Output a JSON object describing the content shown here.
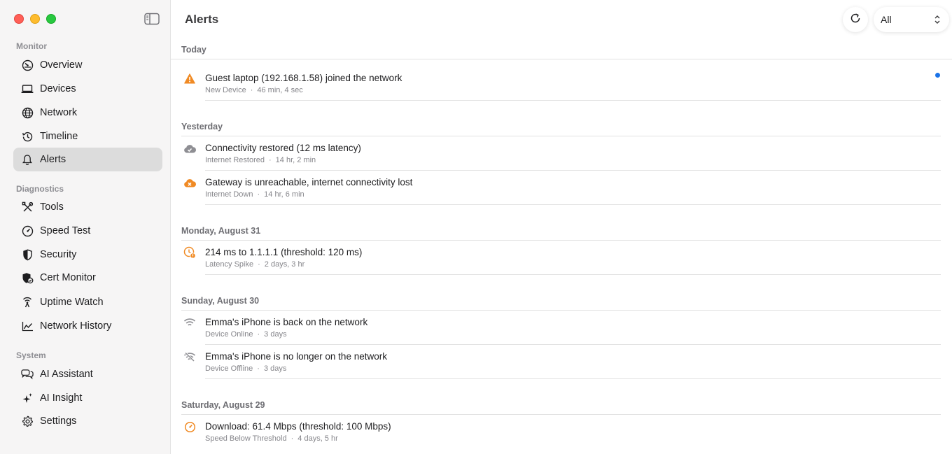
{
  "window": {
    "sidebar": {
      "sections": [
        {
          "label": "Monitor",
          "items": [
            {
              "label": "Overview",
              "icon": "overview-gauge-icon"
            },
            {
              "label": "Devices",
              "icon": "laptop-icon"
            },
            {
              "label": "Network",
              "icon": "globe-icon"
            },
            {
              "label": "Timeline",
              "icon": "clock-icon"
            },
            {
              "label": "Alerts",
              "icon": "bell-icon",
              "active": true
            }
          ]
        },
        {
          "label": "Diagnostics",
          "items": [
            {
              "label": "Tools",
              "icon": "tools-icon"
            },
            {
              "label": "Speed Test",
              "icon": "speedometer-icon"
            },
            {
              "label": "Security",
              "icon": "shield-icon"
            },
            {
              "label": "Cert Monitor",
              "icon": "cert-shield-icon"
            },
            {
              "label": "Uptime Watch",
              "icon": "antenna-icon"
            },
            {
              "label": "Network History",
              "icon": "chart-line-icon"
            }
          ]
        },
        {
          "label": "System",
          "items": [
            {
              "label": "AI Assistant",
              "icon": "chat-bubbles-icon"
            },
            {
              "label": "AI Insight",
              "icon": "sparkles-icon"
            },
            {
              "label": "Settings",
              "icon": "gear-icon"
            }
          ]
        }
      ]
    },
    "header": {
      "title": "Alerts",
      "filter": {
        "selected": "All"
      }
    },
    "groups": [
      {
        "label": "Today",
        "alerts": [
          {
            "title": "Guest laptop (192.168.1.58) joined the network",
            "type": "New Device",
            "age": "46 min, 4 sec",
            "icon": "warning-triangle-icon",
            "color": "#f08a24",
            "unread": true
          }
        ]
      },
      {
        "label": "Yesterday",
        "alerts": [
          {
            "title": "Connectivity restored (12 ms latency)",
            "type": "Internet Restored",
            "age": "14 hr, 2 min",
            "icon": "cloud-check-icon",
            "color": "#8e8e93"
          },
          {
            "title": "Gateway is unreachable, internet connectivity lost",
            "type": "Internet Down",
            "age": "14 hr, 6 min",
            "icon": "cloud-x-icon",
            "color": "#f08a24"
          }
        ]
      },
      {
        "label": "Monday, August 31",
        "alerts": [
          {
            "title": "214 ms to 1.1.1.1 (threshold: 120 ms)",
            "type": "Latency Spike",
            "age": "2 days, 3 hr",
            "icon": "clock-alert-icon",
            "color": "#f08a24"
          }
        ]
      },
      {
        "label": "Sunday, August 30",
        "alerts": [
          {
            "title": "Emma's iPhone is back on the network",
            "type": "Device Online",
            "age": "3 days",
            "icon": "wifi-icon",
            "color": "#8e8e93"
          },
          {
            "title": "Emma's iPhone is no longer on the network",
            "type": "Device Offline",
            "age": "3 days",
            "icon": "wifi-slash-icon",
            "color": "#8e8e93"
          }
        ]
      },
      {
        "label": "Saturday, August 29",
        "alerts": [
          {
            "title": "Download: 61.4 Mbps (threshold: 100 Mbps)",
            "type": "Speed Below Threshold",
            "age": "4 days, 5 hr",
            "icon": "gauge-icon",
            "color": "#f08a24"
          }
        ]
      }
    ],
    "separator": "·",
    "colors": {
      "accent": "#1a73e8",
      "warning": "#f08a24",
      "muted": "#8e8e93"
    }
  }
}
